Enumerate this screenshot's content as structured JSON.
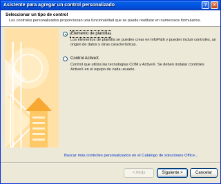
{
  "window": {
    "title": "Asistente para agregar un control personalizado"
  },
  "titlebar": {
    "help_glyph": "?",
    "close_glyph": "×"
  },
  "header": {
    "title": "Seleccionar un tipo de control",
    "description": "Los controles personalizados proporcionan una funcionalidad que se puede reutilizar en numerosos formularios."
  },
  "art": {
    "colors": {
      "background": "#ffe0a6",
      "light": "#fff1cf",
      "mid": "#ffc866",
      "accent": "#f7a830"
    }
  },
  "options": [
    {
      "label": "Elemento de plantilla",
      "description": "Los elementos de plantilla se pueden crear en InfoPath y pueden incluir controles, un origen de datos y otras características.",
      "checked": true
    },
    {
      "label": "Control ActiveX",
      "description": "Control que utiliza las tecnologías COM y ActiveX. Se deben instalar controles ActiveX en el equipo de cada usuario.",
      "checked": false
    }
  ],
  "link": {
    "catalog": "Buscar más controles personalizados en el Catálogo de soluciones Office..."
  },
  "buttons": {
    "back": "< Atrás",
    "next": "Siguiente >",
    "cancel": "Cancelar"
  }
}
